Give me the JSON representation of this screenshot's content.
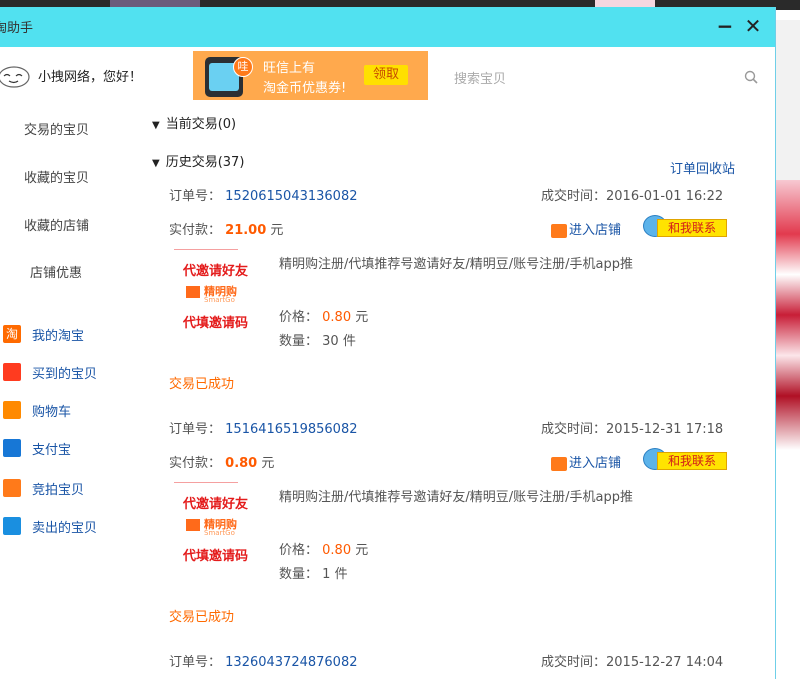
{
  "window": {
    "title": "淘助手",
    "minimize_glyph": "−",
    "close_glyph": "✕"
  },
  "header": {
    "greeting": "小拽网络，您好！",
    "banner": {
      "badge": "哇",
      "line1": "旺信上有",
      "line2": "淘金币优惠券!",
      "claim": "领取"
    },
    "search": {
      "placeholder": "搜索宝贝",
      "value": ""
    }
  },
  "sidebar": {
    "links": [
      {
        "label": "交易的宝贝"
      },
      {
        "label": "收藏的宝贝"
      },
      {
        "label": "收藏的店铺"
      },
      {
        "label": "店铺优惠"
      }
    ],
    "nav": [
      {
        "label": "我的淘宝",
        "icon": "taobao-icon",
        "color": "#ff6a00",
        "glyph": "淘"
      },
      {
        "label": "买到的宝贝",
        "icon": "gift-icon",
        "color": "#ff3b1f",
        "glyph": ""
      },
      {
        "label": "购物车",
        "icon": "cart-icon",
        "color": "#ff8a00",
        "glyph": ""
      },
      {
        "label": "支付宝",
        "icon": "alipay-icon",
        "color": "#1777d6",
        "glyph": ""
      },
      {
        "label": "竞拍宝贝",
        "icon": "auction-icon",
        "color": "#ff7a1a",
        "glyph": ""
      },
      {
        "label": "卖出的宝贝",
        "icon": "sold-icon",
        "color": "#1a8fe0",
        "glyph": ""
      }
    ]
  },
  "main": {
    "current": {
      "label": "当前交易(0)"
    },
    "history": {
      "label": "历史交易(37)"
    },
    "recycle_label": "订单回收站",
    "labels": {
      "order_no": "订单号：",
      "time": "成交时间：",
      "paid": "实付款：",
      "yuan": "元",
      "price": "价格：",
      "qty": "数量：",
      "qty_unit": "件",
      "enter_shop": "进入店铺",
      "contact": "和我联系"
    },
    "orders": [
      {
        "order_no": "1520615043136082",
        "time": "2016-01-01 16:22",
        "paid": "21.00",
        "title": "精明购注册/代填推荐号邀请好友/精明豆/账号注册/手机app推",
        "thumb_top": "代邀请好友",
        "thumb_brand": "精明购",
        "thumb_brand_sub": "SmartGo",
        "thumb_bottom": "代填邀请码",
        "price": "0.80",
        "qty": "30",
        "status": "交易已成功"
      },
      {
        "order_no": "1516416519856082",
        "time": "2015-12-31 17:18",
        "paid": "0.80",
        "title": "精明购注册/代填推荐号邀请好友/精明豆/账号注册/手机app推",
        "thumb_top": "代邀请好友",
        "thumb_brand": "精明购",
        "thumb_brand_sub": "SmartGo",
        "thumb_bottom": "代填邀请码",
        "price": "0.80",
        "qty": "1",
        "status": "交易已成功"
      },
      {
        "order_no": "1326043724876082",
        "time": "2015-12-27 14:04"
      }
    ]
  },
  "colors": {
    "titlebar": "#51e1f0",
    "link": "#1a55a6",
    "accent": "#ff5a00",
    "banner": "#ffa94d"
  }
}
